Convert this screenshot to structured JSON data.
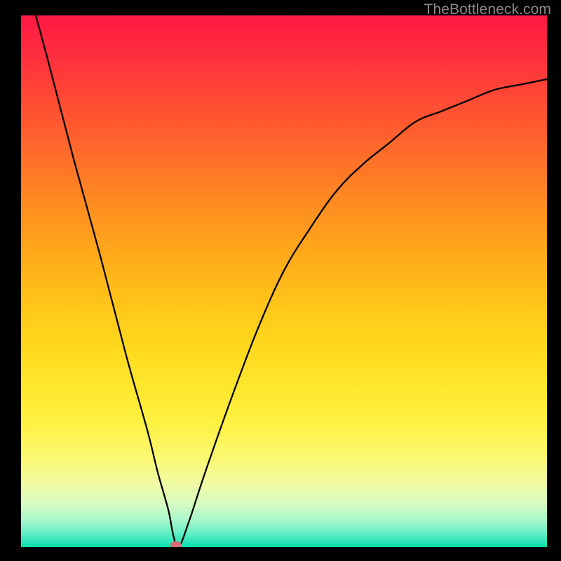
{
  "watermark": "TheBottleneck.com",
  "colors": {
    "frame": "#000000",
    "curve": "#000000",
    "marker": "#d86b74",
    "watermark": "#8a8a8a",
    "gradient_top": "#ff1744",
    "gradient_bottom": "#00dfa9"
  },
  "chart_data": {
    "type": "line",
    "title": "",
    "xlabel": "",
    "ylabel": "",
    "xlim": [
      0,
      100
    ],
    "ylim": [
      0,
      100
    ],
    "grid": false,
    "legend": false,
    "series": [
      {
        "name": "bottleneck-curve",
        "x": [
          0,
          5,
          10,
          15,
          20,
          24,
          26,
          28,
          29,
          30,
          32,
          35,
          40,
          45,
          50,
          55,
          60,
          65,
          70,
          75,
          80,
          85,
          90,
          95,
          100
        ],
        "y": [
          110,
          92,
          73,
          55,
          36,
          22,
          14,
          7,
          2,
          0,
          5,
          14,
          28,
          41,
          52,
          60,
          67,
          72,
          76,
          80,
          82,
          84,
          86,
          87,
          88
        ]
      }
    ],
    "annotations": [
      {
        "name": "minimum-marker",
        "x": 29.5,
        "y": 0
      }
    ]
  }
}
